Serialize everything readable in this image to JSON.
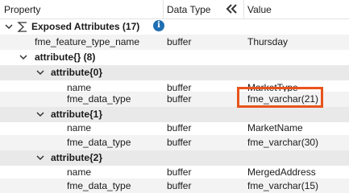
{
  "header": {
    "property": "Property",
    "data_type": "Data Type",
    "value": "Value",
    "collapse_icon": "double-chevron-left-icon"
  },
  "tree": {
    "exposed": {
      "label": "Exposed Attributes (17)",
      "icon": "sigma-icon",
      "info_icon": "info-icon"
    },
    "feature_type": {
      "name": "fme_feature_type_name",
      "type": "buffer",
      "value": "Thursday"
    },
    "attribute_list": {
      "label": "attribute{} (8)"
    },
    "attr0": {
      "label": "attribute{0}",
      "name": {
        "name": "name",
        "type": "buffer",
        "value": "MarketType"
      },
      "dtype": {
        "name": "fme_data_type",
        "type": "buffer",
        "value": "fme_varchar(21)"
      }
    },
    "attr1": {
      "label": "attribute{1}",
      "name": {
        "name": "name",
        "type": "buffer",
        "value": "MarketName"
      },
      "dtype": {
        "name": "fme_data_type",
        "type": "buffer",
        "value": "fme_varchar(30)"
      }
    },
    "attr2": {
      "label": "attribute{2}",
      "name": {
        "name": "name",
        "type": "buffer",
        "value": "MergedAddress"
      },
      "dtype": {
        "name": "fme_data_type",
        "type": "buffer",
        "value": "fme_varchar(15)"
      }
    }
  },
  "colors": {
    "highlight": "#e8541b",
    "info": "#1f6fb2"
  }
}
